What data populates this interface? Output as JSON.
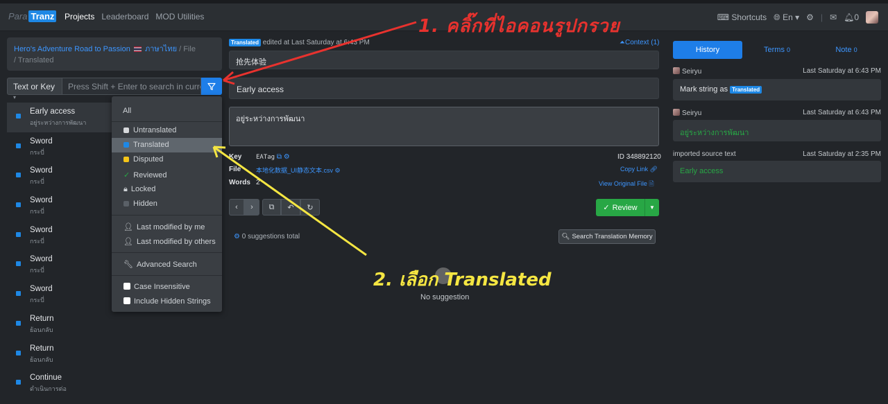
{
  "topbar": {
    "logo_para": "Para",
    "logo_tranz": "Tranz",
    "nav": [
      "Projects",
      "Leaderboard",
      "MOD Utilities"
    ],
    "shortcuts": "Shortcuts",
    "lang": "En",
    "notif_count": "0"
  },
  "breadcrumb": {
    "project": "Hero's Adventure Road to Passion",
    "language": "ภาษาไทย",
    "file": "/ File",
    "current": "/ Translated"
  },
  "search": {
    "mode": "Text or Key",
    "placeholder": "Press Shift + Enter to search in current"
  },
  "strings": [
    {
      "text": "Early access",
      "sub": "อยู่ระหว่างการพัฒนา"
    },
    {
      "text": "Sword",
      "sub": "กระบี่"
    },
    {
      "text": "Sword",
      "sub": "กระบี่"
    },
    {
      "text": "Sword",
      "sub": "กระบี่"
    },
    {
      "text": "Sword",
      "sub": "กระบี่"
    },
    {
      "text": "Sword",
      "sub": "กระบี่"
    },
    {
      "text": "Sword",
      "sub": "กระบี่"
    },
    {
      "text": "Return",
      "sub": "ย้อนกลับ"
    },
    {
      "text": "Return",
      "sub": "ย้อนกลับ"
    },
    {
      "text": "Continue",
      "sub": "ดำเนินการต่อ"
    }
  ],
  "filter_menu": {
    "all": "All",
    "untranslated": "Untranslated",
    "translated": "Translated",
    "disputed": "Disputed",
    "reviewed": "Reviewed",
    "locked": "Locked",
    "hidden": "Hidden",
    "last_modified_me": "Last modified by me",
    "last_modified_others": "Last modified by others",
    "advanced": "Advanced Search",
    "case_insensitive": "Case Insensitive",
    "include_hidden": "Include Hidden Strings"
  },
  "editor": {
    "status_badge": "Translated",
    "edited_text": "edited at Last Saturday at 6:43 PM",
    "context": "Context (1)",
    "source_cn": "抢先体验",
    "original": "Early access",
    "translation": "อยู่ระหว่างการพัฒนา",
    "key_label": "Key",
    "key_value": "EATag",
    "id_text": "ID 348892120",
    "file_label": "File",
    "file_value": "本地化数据_UI静态文本.csv",
    "copy_link": "Copy Link",
    "words_label": "Words",
    "words_value": "2",
    "view_original": "View Original File",
    "review_btn": "Review",
    "suggestions_total": "0 suggestions total",
    "search_tm": "Search Translation Memory",
    "no_suggestion": "No suggestion"
  },
  "right": {
    "tab_history": "History",
    "tab_terms": "Terms",
    "terms_count": "0",
    "tab_note": "Note",
    "note_count": "0",
    "entries": [
      {
        "user": "Seiryu",
        "time": "Last Saturday at 6:43 PM",
        "content_prefix": "Mark string as",
        "badge": "Translated"
      },
      {
        "user": "Seiryu",
        "time": "Last Saturday at 6:43 PM",
        "content": "อยู่ระหว่างการพัฒนา"
      },
      {
        "user": "imported source text",
        "time": "Last Saturday at 2:35 PM",
        "content": "Early access"
      }
    ]
  },
  "annotations": {
    "step1": "1. คลิ๊กที่ไอคอนรูปกรวย",
    "step2": "2. เลือก Translated"
  },
  "colors": {
    "accent": "#1e88e5",
    "green": "#28a745",
    "annot_red": "#e8322e",
    "annot_yellow": "#f5e642"
  }
}
